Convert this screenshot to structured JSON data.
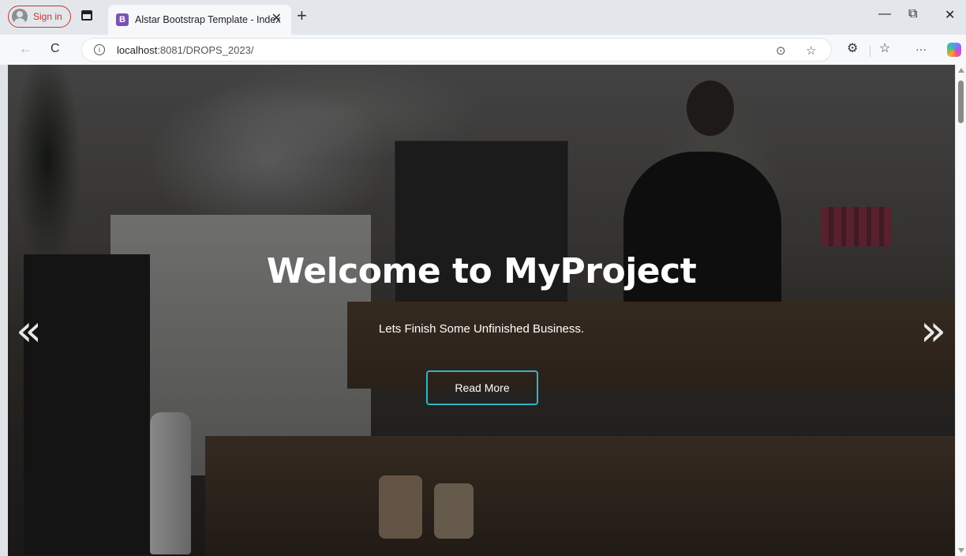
{
  "browser": {
    "sign_in_label": "Sign in",
    "tab": {
      "favicon_letter": "B",
      "title": "Alstar Bootstrap Template - Index",
      "close_glyph": "✕"
    },
    "new_tab_glyph": "+",
    "window_controls": {
      "minimize": "—",
      "restore": "⧉",
      "close": "✕"
    },
    "nav": {
      "back": "←",
      "reload": "C"
    },
    "address": {
      "host": "localhost",
      "path": ":8081/DROPS_2023/"
    },
    "toolbar_icons": [
      "reader-icon",
      "favorite-icon",
      "extensions-icon",
      "favorites-list-icon",
      "more-icon",
      "copilot-icon"
    ],
    "more_glyph": "···"
  },
  "hero": {
    "title": "Welcome to MyProject",
    "subtitle": "Lets Finish Some Unfinished Business.",
    "button_label": "Read More",
    "prev_glyph": "«",
    "next_glyph": "»",
    "accent_color": "#2db7c4"
  }
}
